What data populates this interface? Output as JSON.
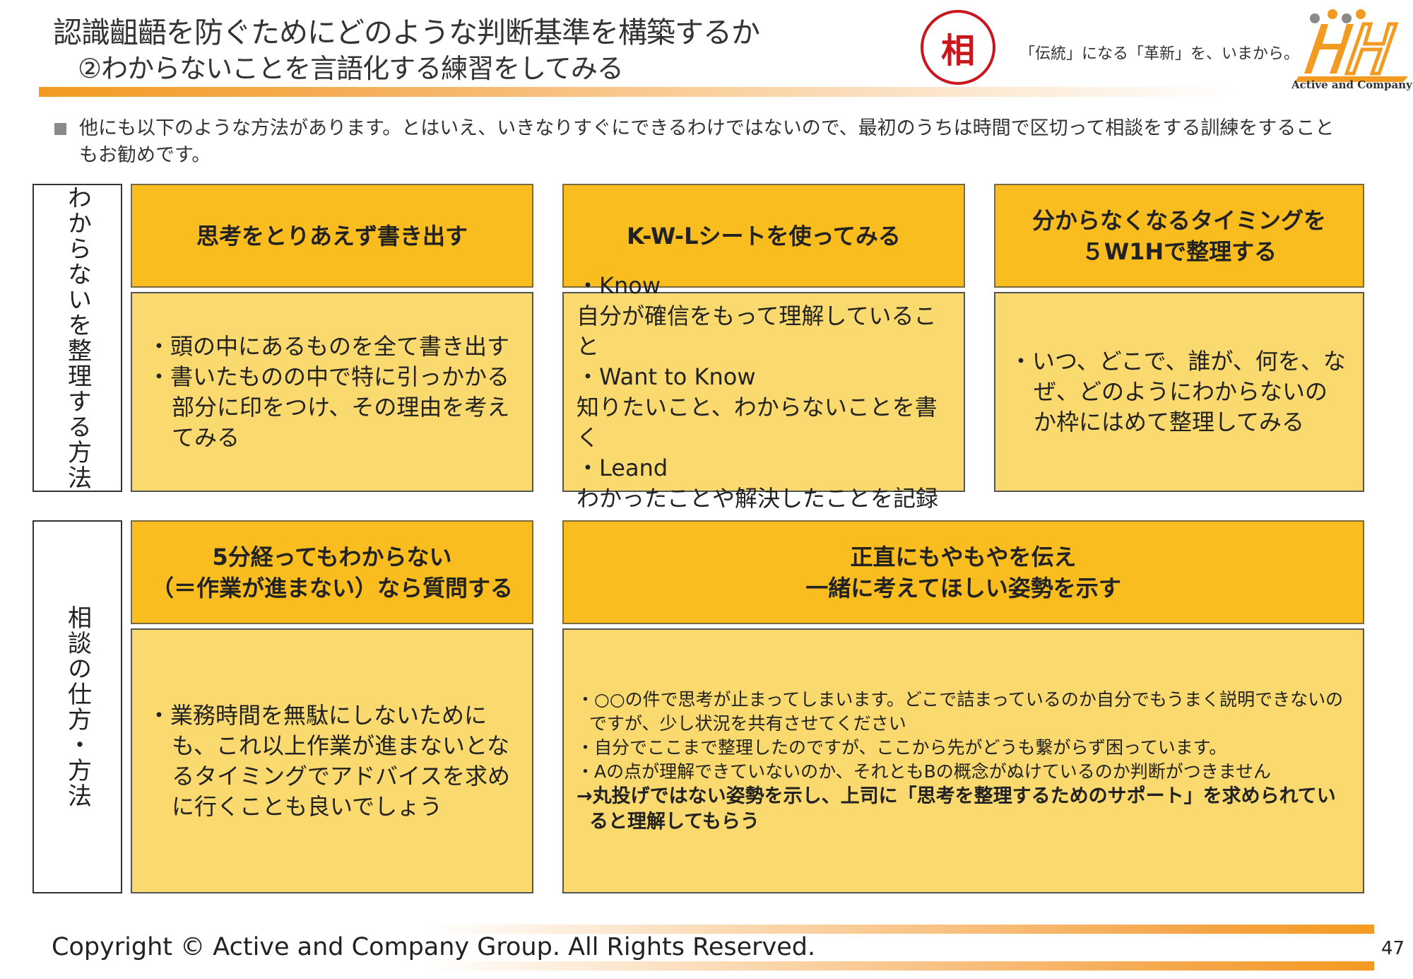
{
  "header": {
    "title": "認識齟齬を防ぐためにどのような判断基準を構築するか",
    "subtitle": "②わからないことを言語化する練習をしてみる",
    "seal": "相",
    "tagline": "「伝統」になる「革新」を、いまから。",
    "logo_text": "Active and Company",
    "accent_color": "#f39a21"
  },
  "intro": "他にも以下のような方法があります。とはいえ、いきなりすぐにできるわけではないので、最初のうちは時間で区切って相談をする訓練をすることもお勧めです。",
  "rows": [
    {
      "label": "わからないを整理する方法",
      "cells": [
        {
          "heading": [
            "思考をとりあえず書き出す"
          ],
          "body": [
            "・頭の中にあるものを全て書き出す",
            "・書いたものの中で特に引っかかる部分に印をつけ、その理由を考えてみる"
          ]
        },
        {
          "heading": [
            "K-W-Lシートを使ってみる"
          ],
          "body": [
            "・Know",
            "自分が確信をもって理解していること",
            "・Want to Know",
            "知りたいこと、わからないことを書く",
            "・Leand",
            "わかったことや解決したことを記録"
          ]
        },
        {
          "heading": [
            "分からなくなるタイミングを",
            "５W1Hで整理する"
          ],
          "body": [
            "・いつ、どこで、誰が、何を、なぜ、どのようにわからないのか枠にはめて整理してみる"
          ]
        }
      ]
    },
    {
      "label": "相談の仕方・方法",
      "cells": [
        {
          "heading": [
            "5分経ってもわからない",
            "（＝作業が進まない）なら質問する"
          ],
          "body": [
            "・業務時間を無駄にしないためにも、これ以上作業が進まないとなるタイミングでアドバイスを求めに行くことも良いでしょう"
          ]
        },
        {
          "heading": [
            "正直にもやもやを伝え",
            "一緒に考えてほしい姿勢を示す"
          ],
          "body": [
            "・○○の件で思考が止まってしまいます。どこで詰まっているのか自分でもうまく説明できないのですが、少し状況を共有させてください",
            "・自分でここまで整理したのですが、ここから先がどうも繋がらず困っています。",
            "・Aの点が理解できていないのか、それともBの概念がぬけているのか判断がつきません"
          ],
          "emphasis": "→丸投げではない姿勢を示し、上司に「思考を整理するためのサポート」を求められていると理解してもらう"
        }
      ]
    }
  ],
  "footer": {
    "copyright": "Copyright © Active and Company Group. All Rights Reserved.",
    "page": "47"
  }
}
